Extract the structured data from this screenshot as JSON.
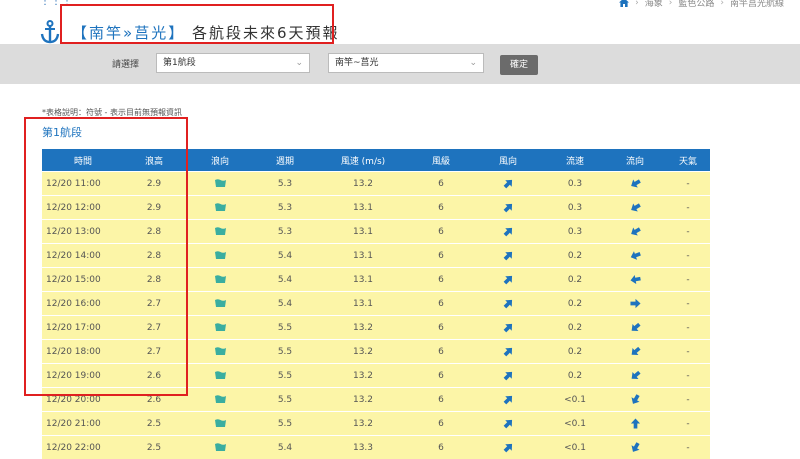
{
  "breadcrumb": {
    "home_icon": "home-icon",
    "items": [
      "海象",
      "藍色公路",
      "南竿莒光航線"
    ]
  },
  "header": {
    "bracket_open": "【",
    "route": "南竿»莒光",
    "bracket_close": "】",
    "subtitle": "各航段未來6天預報"
  },
  "filter": {
    "label": "請選擇",
    "segment_value": "第1航段",
    "route_value": "南竿~莒光",
    "confirm_label": "確定"
  },
  "note": "*表格說明：符號 - 表示目前無預報資訊",
  "section_title": "第1航段",
  "table": {
    "headers": [
      "時間",
      "浪高",
      "浪向",
      "週期",
      "風速 (m/s)",
      "風級",
      "風向",
      "流速",
      "流向",
      "天氣"
    ],
    "rows": [
      {
        "time": "12/20 11:00",
        "wave_height": "2.9",
        "period": "5.3",
        "wind_speed": "13.2",
        "wind_level": "6",
        "current_speed": "0.3",
        "weather": "-"
      },
      {
        "time": "12/20 12:00",
        "wave_height": "2.9",
        "period": "5.3",
        "wind_speed": "13.1",
        "wind_level": "6",
        "current_speed": "0.3",
        "weather": "-"
      },
      {
        "time": "12/20 13:00",
        "wave_height": "2.8",
        "period": "5.3",
        "wind_speed": "13.1",
        "wind_level": "6",
        "current_speed": "0.3",
        "weather": "-"
      },
      {
        "time": "12/20 14:00",
        "wave_height": "2.8",
        "period": "5.4",
        "wind_speed": "13.1",
        "wind_level": "6",
        "current_speed": "0.2",
        "weather": "-"
      },
      {
        "time": "12/20 15:00",
        "wave_height": "2.8",
        "period": "5.4",
        "wind_speed": "13.1",
        "wind_level": "6",
        "current_speed": "0.2",
        "weather": "-"
      },
      {
        "time": "12/20 16:00",
        "wave_height": "2.7",
        "period": "5.4",
        "wind_speed": "13.1",
        "wind_level": "6",
        "current_speed": "0.2",
        "weather": "-"
      },
      {
        "time": "12/20 17:00",
        "wave_height": "2.7",
        "period": "5.5",
        "wind_speed": "13.2",
        "wind_level": "6",
        "current_speed": "0.2",
        "weather": "-"
      },
      {
        "time": "12/20 18:00",
        "wave_height": "2.7",
        "period": "5.5",
        "wind_speed": "13.2",
        "wind_level": "6",
        "current_speed": "0.2",
        "weather": "-"
      },
      {
        "time": "12/20 19:00",
        "wave_height": "2.6",
        "period": "5.5",
        "wind_speed": "13.2",
        "wind_level": "6",
        "current_speed": "0.2",
        "weather": "-"
      },
      {
        "time": "12/20 20:00",
        "wave_height": "2.6",
        "period": "5.5",
        "wind_speed": "13.2",
        "wind_level": "6",
        "current_speed": "<0.1",
        "weather": "-"
      },
      {
        "time": "12/20 21:00",
        "wave_height": "2.5",
        "period": "5.5",
        "wind_speed": "13.2",
        "wind_level": "6",
        "current_speed": "<0.1",
        "weather": "-"
      },
      {
        "time": "12/20 22:00",
        "wave_height": "2.5",
        "period": "5.4",
        "wind_speed": "13.3",
        "wind_level": "6",
        "current_speed": "<0.1",
        "weather": "-"
      }
    ]
  },
  "colors": {
    "accent": "#1e73be",
    "row_bg": "#fcf5a7",
    "wave_icon": "#3aaea0",
    "highlight": "#e02020"
  },
  "icons": {
    "wave_direction": "wave-direction-icon",
    "wind_direction": "wind-arrow-icon",
    "current_direction": "current-arrow-icon"
  }
}
